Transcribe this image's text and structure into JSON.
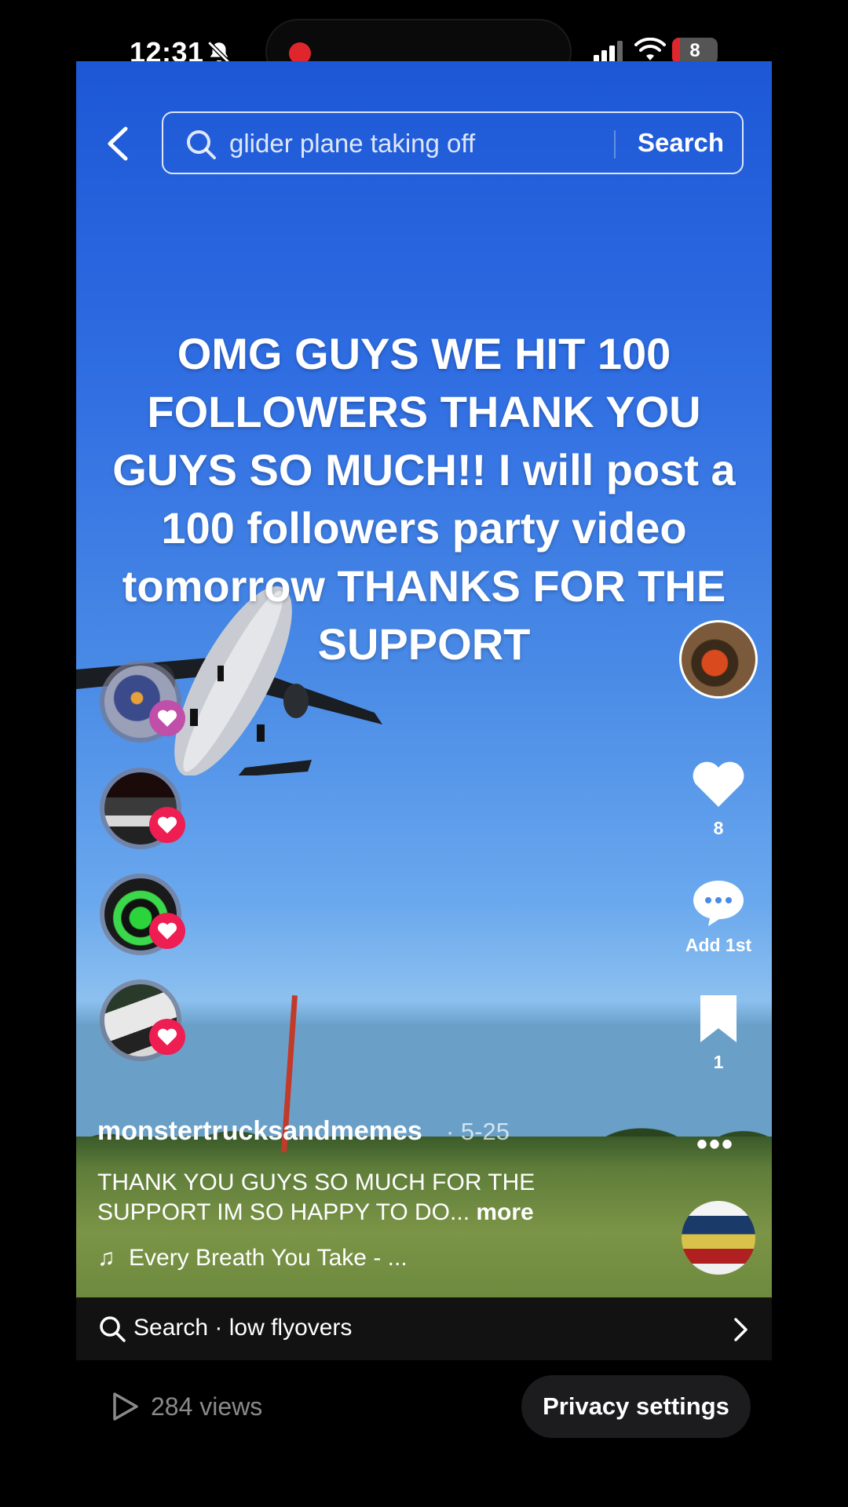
{
  "status_bar": {
    "time": "12:31",
    "battery": "8",
    "icons": [
      "bell-muted-icon",
      "record-indicator",
      "signal-icon",
      "wifi-icon",
      "battery-icon"
    ]
  },
  "search": {
    "query": "glider plane taking off",
    "button": "Search"
  },
  "video": {
    "caption": "OMG GUYS WE HIT 100 FOLLOWERS THANK YOU GUYS SO MUCH!! I will post a 100 followers party video tomorrow THANKS FOR THE SUPPORT"
  },
  "rail": {
    "likes": "8",
    "comments": "Add 1st",
    "saves": "1"
  },
  "post": {
    "username": "monstertrucksandmemes",
    "date": "· 5-25",
    "description": "THANK YOU GUYS SO MUCH FOR THE SUPPORT IM SO HAPPY TO DO...",
    "more": " more",
    "music": "Every Breath You Take - ..."
  },
  "related_search": {
    "label": "Search · low flyovers"
  },
  "footer": {
    "views": "284 views",
    "privacy": "Privacy settings"
  },
  "colors": {
    "accent_red": "#ee1d52",
    "sky_top": "#1d57d6"
  }
}
